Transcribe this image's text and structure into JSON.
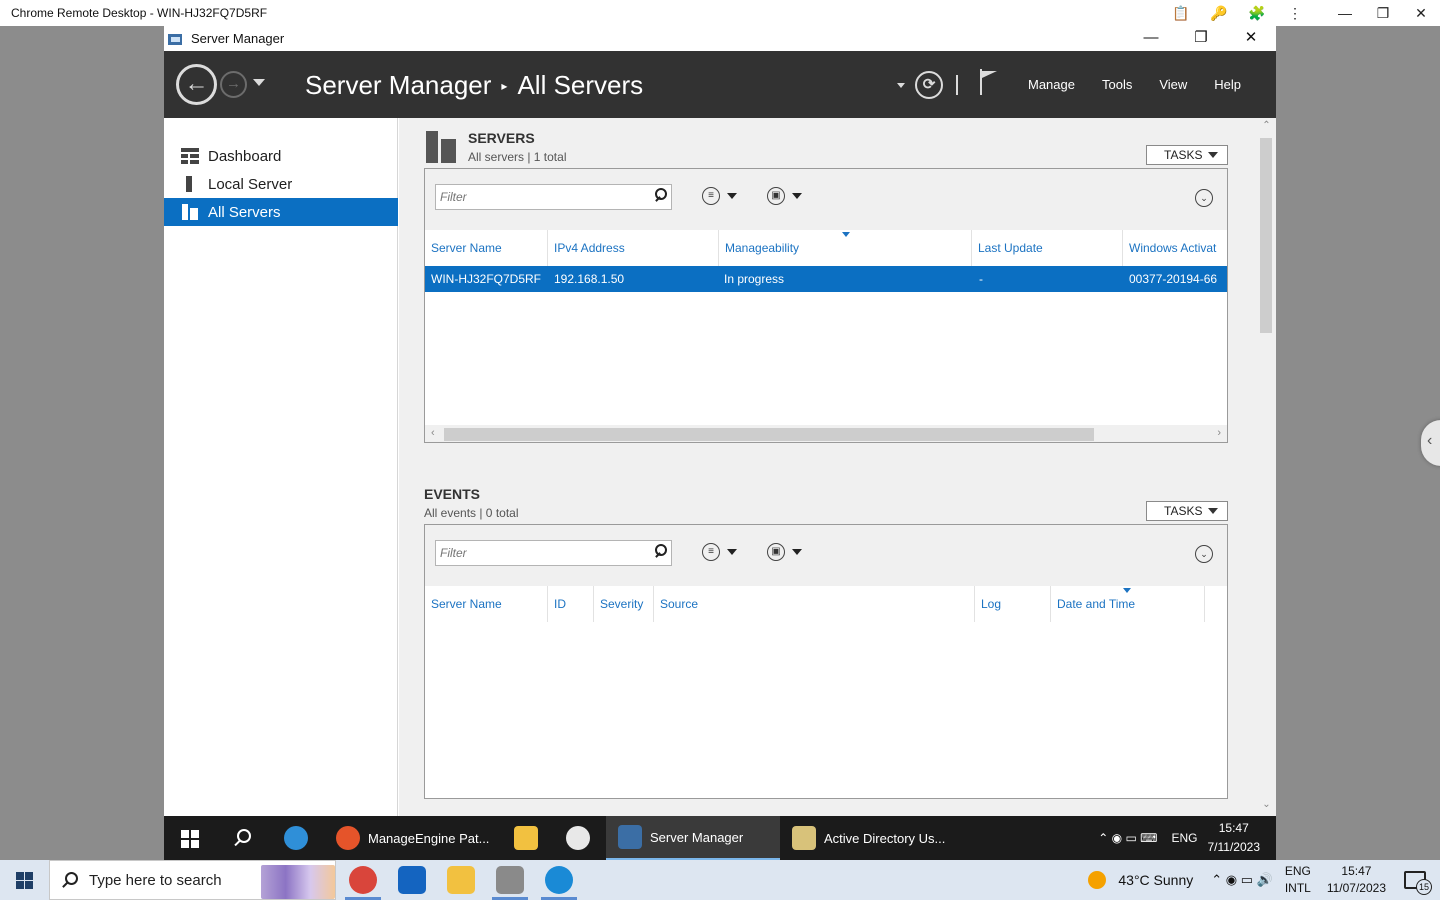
{
  "crd": {
    "title": "Chrome Remote Desktop - WIN-HJ32FQ7D5RF",
    "icons": [
      "clipboard-icon",
      "key-icon",
      "extension-icon",
      "more-icon",
      "minimize-icon",
      "restore-icon",
      "close-icon"
    ],
    "glyphs": {
      "clipboard": "📋",
      "key": "🔑",
      "extension": "🧩",
      "more": "⋮",
      "minimize": "—",
      "restore": "❐",
      "close": "✕"
    }
  },
  "window": {
    "title": "Server Manager",
    "glyphs": {
      "minimize": "—",
      "restore": "❐",
      "close": "✕"
    }
  },
  "header": {
    "breadcrumb": [
      "Server Manager",
      "All Servers"
    ],
    "separator": "▸",
    "menu": [
      "Manage",
      "Tools",
      "View",
      "Help"
    ],
    "glyphs": {
      "back": "←",
      "forward": "→",
      "refresh": "⟳"
    }
  },
  "sidebar": {
    "items": [
      {
        "label": "Dashboard",
        "icon": "dashboard-icon",
        "active": false
      },
      {
        "label": "Local Server",
        "icon": "local-server-icon",
        "active": false
      },
      {
        "label": "All Servers",
        "icon": "all-servers-icon",
        "active": true
      }
    ]
  },
  "servers": {
    "title": "SERVERS",
    "subtitle": "All servers | 1 total",
    "tasks_label": "TASKS",
    "filter_placeholder": "Filter",
    "columns": [
      "Server Name",
      "IPv4 Address",
      "Manageability",
      "Last Update",
      "Windows Activat"
    ],
    "rows": [
      {
        "server_name": "WIN-HJ32FQ7D5RF",
        "ipv4": "192.168.1.50",
        "manageability": "In progress",
        "last_update": "-",
        "activation": "00377-20194-66"
      }
    ],
    "glyphs": {
      "list": "≡",
      "save": "▣",
      "expand": "⌄",
      "scroll_left": "‹",
      "scroll_right": "›"
    }
  },
  "events": {
    "title": "EVENTS",
    "subtitle": "All events | 0 total",
    "tasks_label": "TASKS",
    "filter_placeholder": "Filter",
    "columns": [
      "Server Name",
      "ID",
      "Severity",
      "Source",
      "Log",
      "Date and Time"
    ]
  },
  "scroll_glyphs": {
    "up": "⌃",
    "down": "⌄"
  },
  "remote_taskbar": {
    "apps": [
      {
        "label": "ManageEngine Pat...",
        "icon": "firefox-icon",
        "color": "#e5542a",
        "active": false
      },
      {
        "label": "Server Manager",
        "icon": "server-manager-icon",
        "color": "#3b6ea5",
        "active": true
      },
      {
        "label": "Active Directory Us...",
        "icon": "active-directory-icon",
        "color": "#d8c27a",
        "active": false
      }
    ],
    "pinned_icons": [
      "ie-icon",
      "file-explorer-icon",
      "power-icon"
    ],
    "tray": {
      "glyphs": "⌃  ◉  ▭  ⌨",
      "language": "ENG",
      "time": "15:47",
      "date": "7/11/2023"
    }
  },
  "local_taskbar": {
    "search_placeholder": "Type here to search",
    "pinned": [
      {
        "icon": "chrome-icon",
        "color": "#d9453b",
        "active": true
      },
      {
        "icon": "outlook-icon",
        "color": "#1464c0",
        "active": false
      },
      {
        "icon": "file-explorer-icon",
        "color": "#f2c140",
        "active": false
      },
      {
        "icon": "remote-desktop-icon",
        "color": "#8a8a8a",
        "active": true
      },
      {
        "icon": "edge-icon",
        "color": "#1a8ad6",
        "active": true
      }
    ],
    "weather": "43°C  Sunny",
    "tray_glyphs": "⌃  ◉  ▭  🔊",
    "language": [
      "ENG",
      "INTL"
    ],
    "time": "15:47",
    "date": "11/07/2023",
    "notification_count": "15"
  },
  "side_tab_glyph": "‹"
}
